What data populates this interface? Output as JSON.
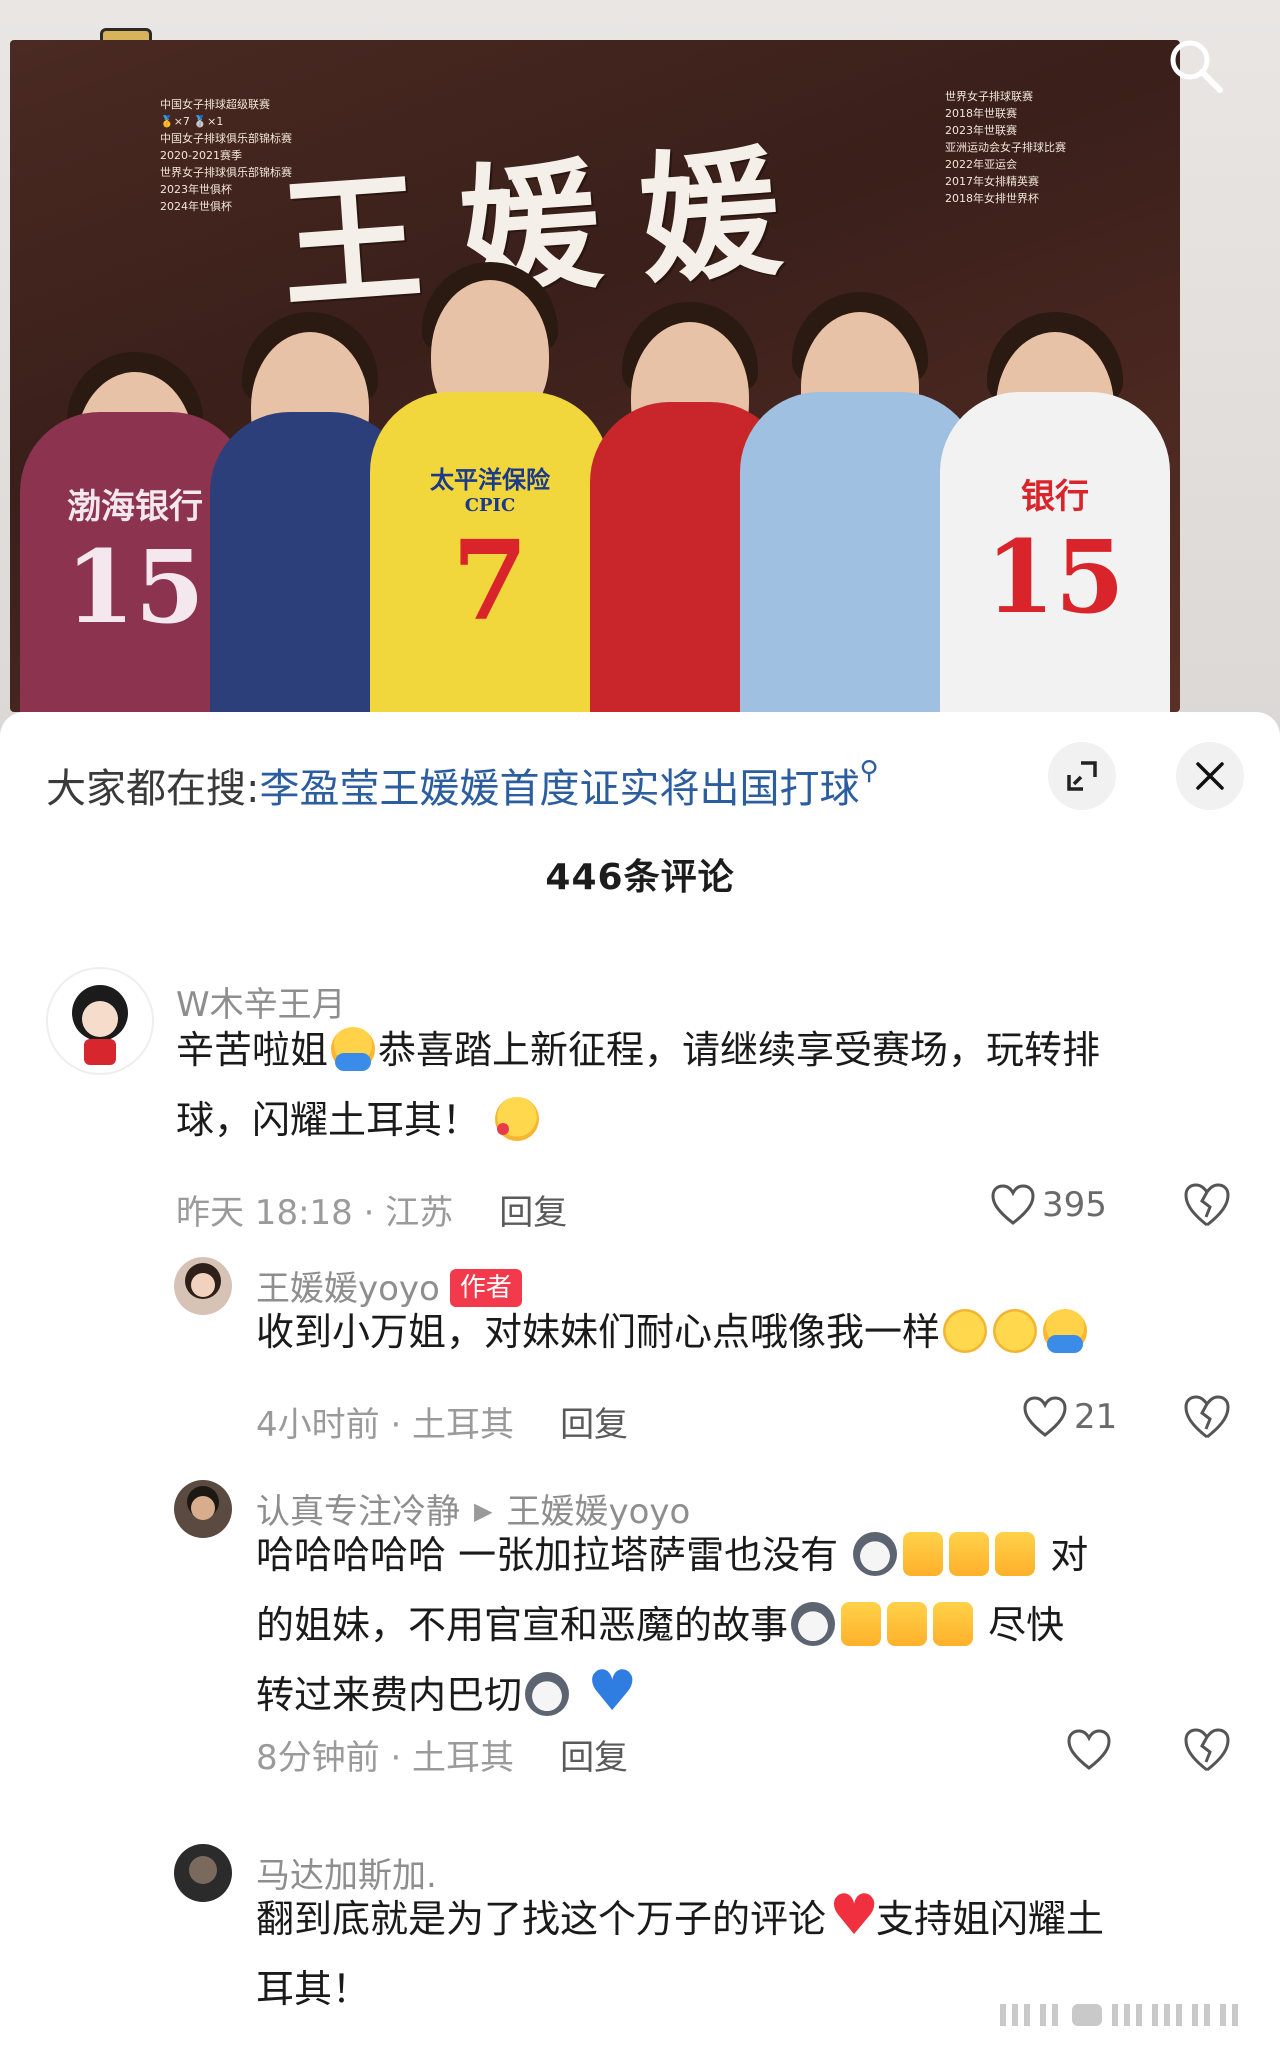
{
  "hero": {
    "banner_title": "王媛媛",
    "honors_left": [
      "中国女子排球超级联赛",
      "🥇×7 🥈×1",
      "中国女子排球俱乐部锦标赛",
      "2020-2021赛季",
      "世界女子排球俱乐部锦标赛",
      "2023年世俱杯",
      "2024年世俱杯"
    ],
    "honors_right": [
      "世界女子排球联赛",
      "2018年世联赛",
      "2023年世联赛",
      "亚洲运动会女子排球比赛",
      "2022年亚运会",
      "2017年女排精英赛",
      "2018年女排世界杯"
    ],
    "jersey_numbers": [
      "15",
      "7",
      "15"
    ],
    "jersey_text": [
      "渤海银行",
      "太平洋保险",
      "CPIC",
      "银行"
    ]
  },
  "sheet": {
    "trend_prefix": "大家都在搜:",
    "trend_link": "李盈莹王媛媛首度证实将出国打球",
    "comment_count": "446条评论"
  },
  "comments": [
    {
      "username": "W木辛王月",
      "text_parts": [
        "辛苦啦姐",
        "恭喜踏上新征程，请继续享受赛场，玩转排",
        "球，闪耀土耳其！"
      ],
      "time": "昨天 18:18 · 江苏",
      "reply_label": "回复",
      "likes": "395"
    },
    {
      "username": "王媛媛yoyo",
      "badge": "作者",
      "text": "收到小万姐，对妹妹们耐心点哦像我一样",
      "time": "4小时前 · 土耳其",
      "reply_label": "回复",
      "likes": "21"
    },
    {
      "username": "认真专注冷静",
      "reply_to": "王媛媛yoyo",
      "text_parts": [
        "哈哈哈哈哈 一张加拉塔萨雷也没有",
        "对",
        "的姐妹，不用官宣和恶魔的故事",
        "尽快",
        "转过来费内巴切"
      ],
      "time": "8分钟前 · 土耳其",
      "reply_label": "回复"
    },
    {
      "username": "马达加斯加.",
      "text_parts": [
        "翻到底就是为了找这个万子的评论",
        "支持姐闪耀土",
        "耳其！"
      ]
    }
  ]
}
